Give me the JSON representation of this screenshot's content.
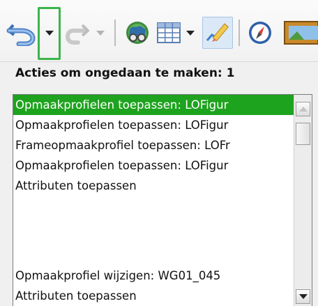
{
  "toolbar": {
    "buttons": [
      {
        "name": "undo-button",
        "icon": "undo-icon"
      },
      {
        "name": "undo-dropdown",
        "icon": "chevron-down-icon",
        "open": true
      },
      {
        "name": "redo-button",
        "icon": "redo-icon",
        "disabled": true
      },
      {
        "name": "redo-dropdown",
        "icon": "chevron-down-icon",
        "disabled": true
      },
      {
        "name": "navigator-button",
        "icon": "navigator-icon"
      },
      {
        "name": "table-button",
        "icon": "table-grid-icon"
      },
      {
        "name": "table-dropdown",
        "icon": "chevron-down-icon"
      },
      {
        "name": "draw-functions-button",
        "icon": "pencil-chart-icon",
        "active": true
      },
      {
        "name": "compass-button",
        "icon": "compass-icon"
      },
      {
        "name": "gallery-button",
        "icon": "gallery-frame-icon"
      }
    ],
    "highlight_color": "#3bb54a"
  },
  "undo_panel": {
    "title": "Acties om ongedaan te maken: 1",
    "items": [
      {
        "label": "Opmaakprofielen toepassen: LOFigur",
        "selected": true
      },
      {
        "label": "Opmaakprofielen toepassen: LOFigur",
        "selected": false
      },
      {
        "label": "Frameopmaakprofiel toepassen: LOFr",
        "selected": false
      },
      {
        "label": "Opmaakprofielen toepassen: LOFigur",
        "selected": false
      },
      {
        "label": "Attributen toepassen",
        "selected": false
      },
      {
        "label": "",
        "selected": false
      },
      {
        "label": "",
        "selected": false
      },
      {
        "label": "",
        "selected": false
      },
      {
        "label": "Opmaakprofiel wijzigen: WG01_045",
        "selected": false
      },
      {
        "label": "Attributen toepassen",
        "selected": false
      }
    ],
    "selection_color": "#1ea31e"
  }
}
